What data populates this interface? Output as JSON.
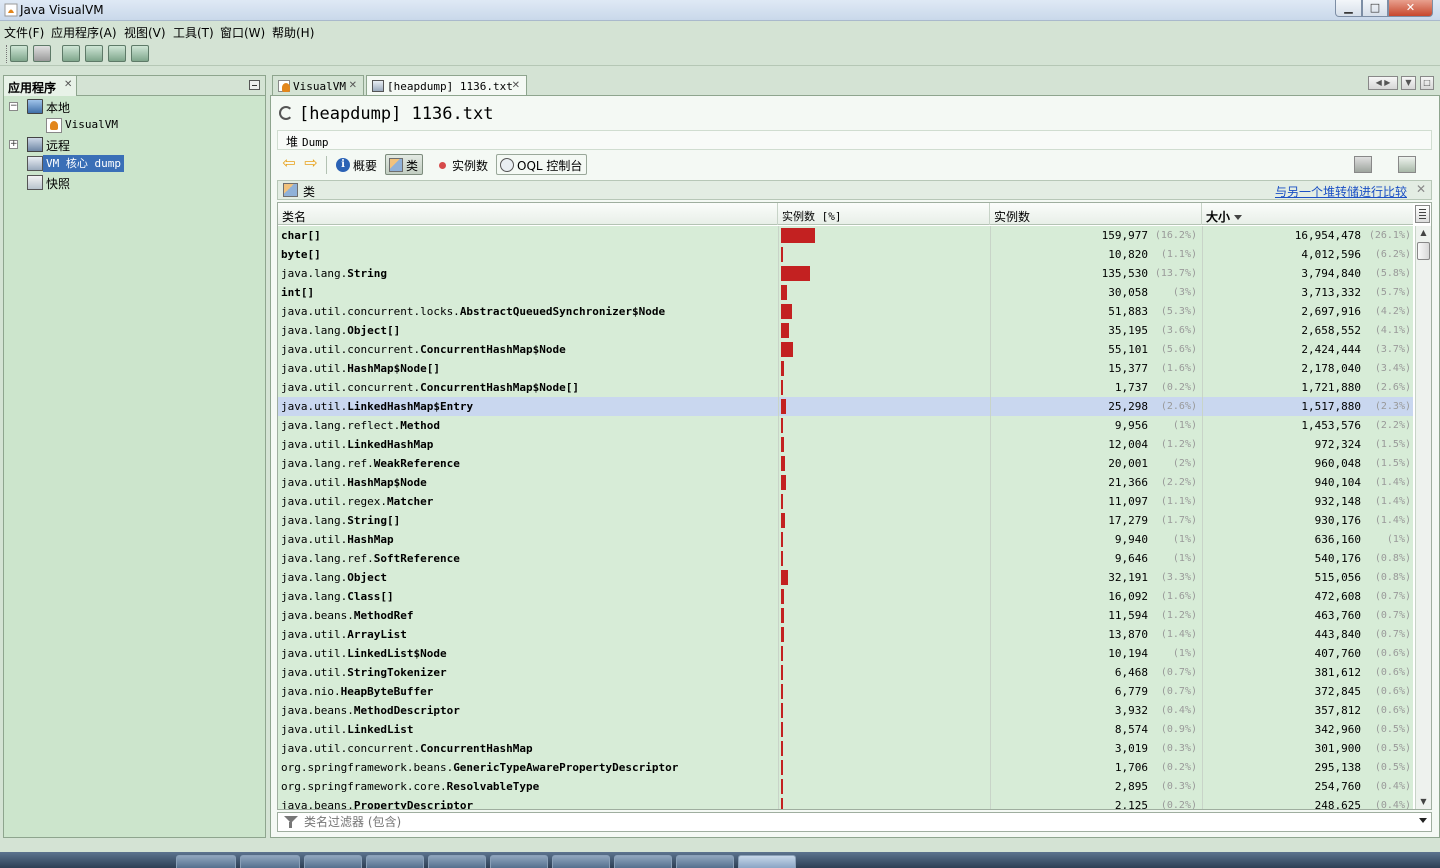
{
  "window": {
    "title": "Java VisualVM"
  },
  "menu": [
    "文件(F)",
    "应用程序(A)",
    "视图(V)",
    "工具(T)",
    "窗口(W)",
    "帮助(H)"
  ],
  "left_panel": {
    "tab_label": "应用程序",
    "tree": [
      {
        "label": "本地"
      },
      {
        "label": "VisualVM"
      },
      {
        "label": "远程"
      },
      {
        "label": "VM 核心 dump"
      },
      {
        "label": "快照"
      }
    ]
  },
  "tabs": [
    {
      "label": "VisualVM"
    },
    {
      "label": "[heapdump] 1136.txt"
    }
  ],
  "document": {
    "title": "[heapdump] 1136.txt",
    "subheader": {
      "prefix": "堆",
      "text": "Dump"
    }
  },
  "views": {
    "summary": "概要",
    "classes": "类",
    "instances": "实例数",
    "oql": "OQL 控制台"
  },
  "classes_panel": {
    "label": "类",
    "compare_link": "与另一个堆转储进行比较"
  },
  "table": {
    "columns": {
      "name": "类名",
      "instances_bar": "实例数 [%]",
      "instances": "实例数",
      "size": "大小"
    },
    "sort": {
      "column": "size",
      "order": "descending"
    },
    "rows": [
      {
        "pkg": "",
        "cls": "char[]",
        "count": "159,977",
        "count_pct": "(16.2%)",
        "size": "16,954,478",
        "size_pct": "(26.1%)",
        "bar_pct": 16.2
      },
      {
        "pkg": "",
        "cls": "byte[]",
        "count": "10,820",
        "count_pct": "(1.1%)",
        "size": "4,012,596",
        "size_pct": "(6.2%)",
        "bar_pct": 1.1
      },
      {
        "pkg": "java.lang.",
        "cls": "String",
        "count": "135,530",
        "count_pct": "(13.7%)",
        "size": "3,794,840",
        "size_pct": "(5.8%)",
        "bar_pct": 13.7
      },
      {
        "pkg": "",
        "cls": "int[]",
        "count": "30,058",
        "count_pct": "(3%)",
        "size": "3,713,332",
        "size_pct": "(5.7%)",
        "bar_pct": 3
      },
      {
        "pkg": "java.util.concurrent.locks.",
        "cls": "AbstractQueuedSynchronizer$Node",
        "count": "51,883",
        "count_pct": "(5.3%)",
        "size": "2,697,916",
        "size_pct": "(4.2%)",
        "bar_pct": 5.3
      },
      {
        "pkg": "java.lang.",
        "cls": "Object[]",
        "count": "35,195",
        "count_pct": "(3.6%)",
        "size": "2,658,552",
        "size_pct": "(4.1%)",
        "bar_pct": 3.6
      },
      {
        "pkg": "java.util.concurrent.",
        "cls": "ConcurrentHashMap$Node",
        "count": "55,101",
        "count_pct": "(5.6%)",
        "size": "2,424,444",
        "size_pct": "(3.7%)",
        "bar_pct": 5.6
      },
      {
        "pkg": "java.util.",
        "cls": "HashMap$Node[]",
        "count": "15,377",
        "count_pct": "(1.6%)",
        "size": "2,178,040",
        "size_pct": "(3.4%)",
        "bar_pct": 1.6
      },
      {
        "pkg": "java.util.concurrent.",
        "cls": "ConcurrentHashMap$Node[]",
        "count": "1,737",
        "count_pct": "(0.2%)",
        "size": "1,721,880",
        "size_pct": "(2.6%)",
        "bar_pct": 0.2
      },
      {
        "pkg": "java.util.",
        "cls": "LinkedHashMap$Entry",
        "count": "25,298",
        "count_pct": "(2.6%)",
        "size": "1,517,880",
        "size_pct": "(2.3%)",
        "bar_pct": 2.6,
        "selected": true
      },
      {
        "pkg": "java.lang.reflect.",
        "cls": "Method",
        "count": "9,956",
        "count_pct": "(1%)",
        "size": "1,453,576",
        "size_pct": "(2.2%)",
        "bar_pct": 1
      },
      {
        "pkg": "java.util.",
        "cls": "LinkedHashMap",
        "count": "12,004",
        "count_pct": "(1.2%)",
        "size": "972,324",
        "size_pct": "(1.5%)",
        "bar_pct": 1.2
      },
      {
        "pkg": "java.lang.ref.",
        "cls": "WeakReference",
        "count": "20,001",
        "count_pct": "(2%)",
        "size": "960,048",
        "size_pct": "(1.5%)",
        "bar_pct": 2
      },
      {
        "pkg": "java.util.",
        "cls": "HashMap$Node",
        "count": "21,366",
        "count_pct": "(2.2%)",
        "size": "940,104",
        "size_pct": "(1.4%)",
        "bar_pct": 2.2
      },
      {
        "pkg": "java.util.regex.",
        "cls": "Matcher",
        "count": "11,097",
        "count_pct": "(1.1%)",
        "size": "932,148",
        "size_pct": "(1.4%)",
        "bar_pct": 1.1
      },
      {
        "pkg": "java.lang.",
        "cls": "String[]",
        "count": "17,279",
        "count_pct": "(1.7%)",
        "size": "930,176",
        "size_pct": "(1.4%)",
        "bar_pct": 1.7
      },
      {
        "pkg": "java.util.",
        "cls": "HashMap",
        "count": "9,940",
        "count_pct": "(1%)",
        "size": "636,160",
        "size_pct": "(1%)",
        "bar_pct": 1
      },
      {
        "pkg": "java.lang.ref.",
        "cls": "SoftReference",
        "count": "9,646",
        "count_pct": "(1%)",
        "size": "540,176",
        "size_pct": "(0.8%)",
        "bar_pct": 1
      },
      {
        "pkg": "java.lang.",
        "cls": "Object",
        "count": "32,191",
        "count_pct": "(3.3%)",
        "size": "515,056",
        "size_pct": "(0.8%)",
        "bar_pct": 3.3
      },
      {
        "pkg": "java.lang.",
        "cls": "Class[]",
        "count": "16,092",
        "count_pct": "(1.6%)",
        "size": "472,608",
        "size_pct": "(0.7%)",
        "bar_pct": 1.6
      },
      {
        "pkg": "java.beans.",
        "cls": "MethodRef",
        "count": "11,594",
        "count_pct": "(1.2%)",
        "size": "463,760",
        "size_pct": "(0.7%)",
        "bar_pct": 1.2
      },
      {
        "pkg": "java.util.",
        "cls": "ArrayList",
        "count": "13,870",
        "count_pct": "(1.4%)",
        "size": "443,840",
        "size_pct": "(0.7%)",
        "bar_pct": 1.4
      },
      {
        "pkg": "java.util.",
        "cls": "LinkedList$Node",
        "count": "10,194",
        "count_pct": "(1%)",
        "size": "407,760",
        "size_pct": "(0.6%)",
        "bar_pct": 1
      },
      {
        "pkg": "java.util.",
        "cls": "StringTokenizer",
        "count": "6,468",
        "count_pct": "(0.7%)",
        "size": "381,612",
        "size_pct": "(0.6%)",
        "bar_pct": 0.7
      },
      {
        "pkg": "java.nio.",
        "cls": "HeapByteBuffer",
        "count": "6,779",
        "count_pct": "(0.7%)",
        "size": "372,845",
        "size_pct": "(0.6%)",
        "bar_pct": 0.7
      },
      {
        "pkg": "java.beans.",
        "cls": "MethodDescriptor",
        "count": "3,932",
        "count_pct": "(0.4%)",
        "size": "357,812",
        "size_pct": "(0.6%)",
        "bar_pct": 0.4
      },
      {
        "pkg": "java.util.",
        "cls": "LinkedList",
        "count": "8,574",
        "count_pct": "(0.9%)",
        "size": "342,960",
        "size_pct": "(0.5%)",
        "bar_pct": 0.9
      },
      {
        "pkg": "java.util.concurrent.",
        "cls": "ConcurrentHashMap",
        "count": "3,019",
        "count_pct": "(0.3%)",
        "size": "301,900",
        "size_pct": "(0.5%)",
        "bar_pct": 0.3
      },
      {
        "pkg": "org.springframework.beans.",
        "cls": "GenericTypeAwarePropertyDescriptor",
        "count": "1,706",
        "count_pct": "(0.2%)",
        "size": "295,138",
        "size_pct": "(0.5%)",
        "bar_pct": 0.2
      },
      {
        "pkg": "org.springframework.core.",
        "cls": "ResolvableType",
        "count": "2,895",
        "count_pct": "(0.3%)",
        "size": "254,760",
        "size_pct": "(0.4%)",
        "bar_pct": 0.3
      },
      {
        "pkg": "java.beans.",
        "cls": "PropertyDescriptor",
        "count": "2,125",
        "count_pct": "(0.2%)",
        "size": "248,625",
        "size_pct": "(0.4%)",
        "bar_pct": 0.2
      }
    ]
  },
  "filter": {
    "placeholder": "类名过滤器 (包含)"
  },
  "colors": {
    "bar": "#c32121",
    "row": "#d7ecd7",
    "row_selected": "#c9d7ef",
    "link": "#1a4fc4"
  },
  "icons": [
    "java-app-icon",
    "minimize-icon",
    "maximize-icon",
    "close-icon",
    "open-icon",
    "save-icon",
    "heap-dump-icon",
    "thread-dump-icon",
    "snapshot-icon",
    "monitor-icon",
    "java-vm-icon",
    "remote-icon",
    "core-dump-icon",
    "snapshot-icon",
    "back-arrow-icon",
    "forward-arrow-icon",
    "info-icon",
    "classes-icon",
    "instances-icon",
    "oql-icon",
    "filter-icon",
    "column-selector-icon"
  ]
}
